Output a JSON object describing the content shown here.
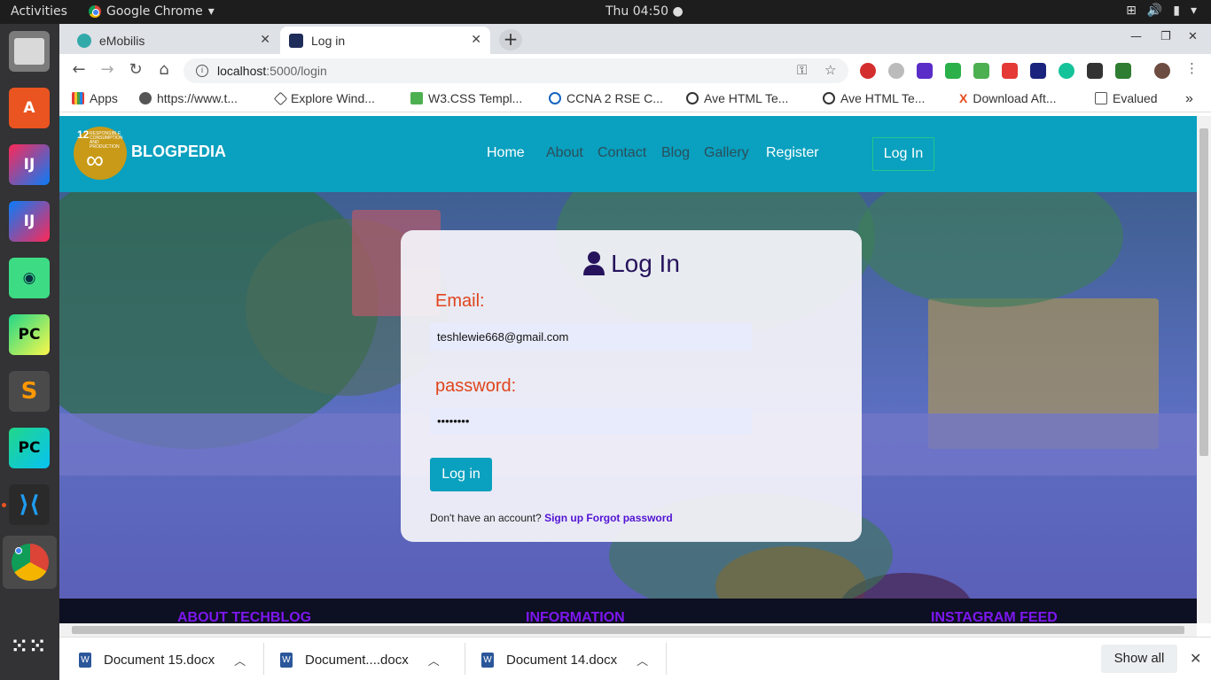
{
  "system": {
    "activities": "Activities",
    "app_name": "Google Chrome",
    "clock": "Thu 04:50"
  },
  "tabs": [
    {
      "label": "eMobilis"
    },
    {
      "label": "Log in"
    }
  ],
  "address": {
    "host": "localhost",
    "path": ":5000/login"
  },
  "bookmarks": [
    {
      "label": "Apps"
    },
    {
      "label": "https://www.t..."
    },
    {
      "label": "Explore Wind..."
    },
    {
      "label": "W3.CSS Templ..."
    },
    {
      "label": "CCNA 2 RSE C..."
    },
    {
      "label": "Ave HTML Te..."
    },
    {
      "label": "Ave HTML Te..."
    },
    {
      "label": "Download Aft..."
    },
    {
      "label": "Evalued"
    }
  ],
  "site": {
    "brand": "BLOGPEDIA",
    "logo_number": "12",
    "logo_text": "RESPONSIBLE CONSUMPTION AND PRODUCTION",
    "nav": [
      "Home",
      "About",
      "Contact",
      "Blog",
      "Gallery",
      "Register"
    ],
    "nav_login": "Log In"
  },
  "login": {
    "title": "Log In",
    "email_label": "Email:",
    "email_value": "teshlewie668@gmail.com",
    "password_label": "password:",
    "password_value": "••••••••",
    "submit": "Log in",
    "signup_prompt": "Don't have an account?",
    "signup_link": "Sign up",
    "forgot_link": "Forgot password"
  },
  "footer": {
    "headings": [
      "ABOUT TECHBLOG",
      "INFORMATION",
      "INSTAGRAM FEED"
    ]
  },
  "downloads": [
    {
      "name": "Document 15.docx"
    },
    {
      "name": "Document....docx"
    },
    {
      "name": "Document 14.docx"
    }
  ],
  "shelf": {
    "show_all": "Show all"
  },
  "colors": {
    "nav_bg": "#0aa0bf",
    "label_orange": "#e0441c",
    "title_purple": "#26135c",
    "link_purple": "#5213d4",
    "footer_heading": "#7d17f0"
  }
}
